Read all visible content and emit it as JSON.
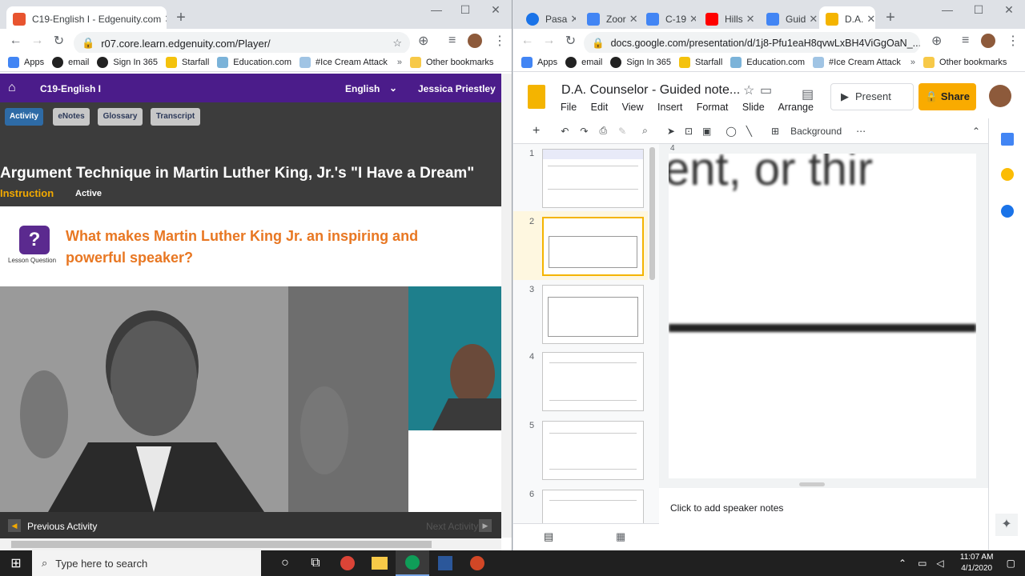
{
  "left": {
    "tabs": [
      {
        "label": "C19-English I - Edgenuity.com"
      }
    ],
    "url": "r07.core.learn.edgenuity.com/Player/",
    "bookmarks": [
      {
        "label": "Apps",
        "icon": "apps-grid-icon"
      },
      {
        "label": "email",
        "icon": "github-icon"
      },
      {
        "label": "Sign In 365",
        "icon": "github-icon"
      },
      {
        "label": "Starfall",
        "icon": "star-icon"
      },
      {
        "label": "Education.com",
        "icon": "education-icon"
      },
      {
        "label": "#Ice Cream Attack",
        "icon": "game-icon"
      },
      {
        "label": "Other bookmarks",
        "icon": "folder-icon"
      }
    ],
    "app": {
      "course": "C19-English I",
      "language": "English",
      "user": "Jessica Priestley",
      "tabs": [
        "Activity",
        "eNotes",
        "Glossary",
        "Transcript"
      ],
      "title": "Argument Technique in Martin Luther King, Jr.'s \"I Have a Dream\"",
      "mode": "Instruction",
      "status": "Active",
      "lesson_label": "Lesson Question",
      "question": "What makes Martin Luther King Jr. an inspiring and powerful speaker?",
      "prev": "Previous Activity",
      "next": "Next Activity"
    }
  },
  "right": {
    "tabs": [
      {
        "label": "Pasa",
        "color": "#1a73e8"
      },
      {
        "label": "Zoor",
        "color": "#4285f4"
      },
      {
        "label": "C-19",
        "color": "#4285f4"
      },
      {
        "label": "Hills",
        "color": "#ff0000"
      },
      {
        "label": "Guid",
        "color": "#4285f4"
      },
      {
        "label": "D.A.",
        "color": "#f4b400"
      }
    ],
    "url": "docs.google.com/presentation/d/1j8-Pfu1eaH8qvwLxBH4ViGgOaN_...",
    "slides": {
      "title": "D.A. Counselor - Guided note...",
      "menu": [
        "File",
        "Edit",
        "View",
        "Insert",
        "Format",
        "Slide",
        "Arrange"
      ],
      "present": "Present",
      "share": "Share",
      "background": "Background",
      "slide_numbers": [
        "1",
        "2",
        "3",
        "4",
        "5",
        "6"
      ],
      "canvas_text": "ent, or thir",
      "speaker_notes": "Click to add speaker notes",
      "ruler_mark": "4"
    }
  },
  "taskbar": {
    "search_placeholder": "Type here to search",
    "time": "11:07 AM",
    "date": "4/1/2020"
  }
}
